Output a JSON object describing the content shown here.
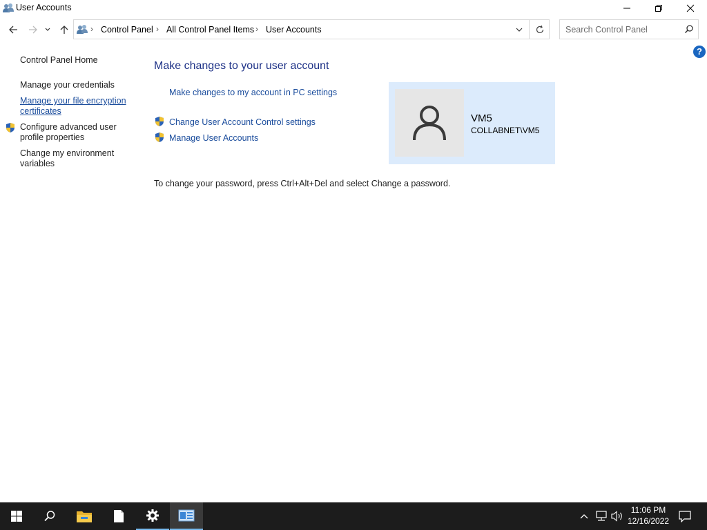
{
  "window": {
    "title": "User Accounts",
    "controls": {
      "minimize": "minimize-icon",
      "restore": "restore-icon",
      "close": "close-icon"
    }
  },
  "nav": {
    "breadcrumbs": [
      "Control Panel",
      "All Control Panel Items",
      "User Accounts"
    ],
    "search_placeholder": "Search Control Panel"
  },
  "sidebar": {
    "home": "Control Panel Home",
    "items": [
      {
        "line1": "Manage your credentials",
        "line2": ""
      },
      {
        "line1": "Manage your file encryption",
        "line2": "certificates"
      },
      {
        "line1": "Configure advanced user",
        "line2": "profile properties"
      },
      {
        "line1": "Change my environment",
        "line2": "variables"
      }
    ]
  },
  "main": {
    "heading": "Make changes to your user account",
    "links": [
      "Make changes to my account in PC settings",
      "Change User Account Control settings",
      "Manage User Accounts"
    ],
    "password_note": "To change your password, press Ctrl+Alt+Del and select Change a password."
  },
  "user": {
    "name": "VM5",
    "domain_account": "COLLABNET\\VM5"
  },
  "taskbar": {
    "apps": [
      "start-icon",
      "search-icon",
      "file-explorer-icon",
      "notepad-icon",
      "settings-icon",
      "control-panel-icon"
    ],
    "time": "11:06 PM",
    "date": "12/16/2022"
  },
  "colors": {
    "link": "#1a4c9c",
    "heading": "#1e3287",
    "user_card_bg": "#dcebfc",
    "taskbar_bg": "#1c1c1c",
    "accent": "#76b9ed"
  }
}
